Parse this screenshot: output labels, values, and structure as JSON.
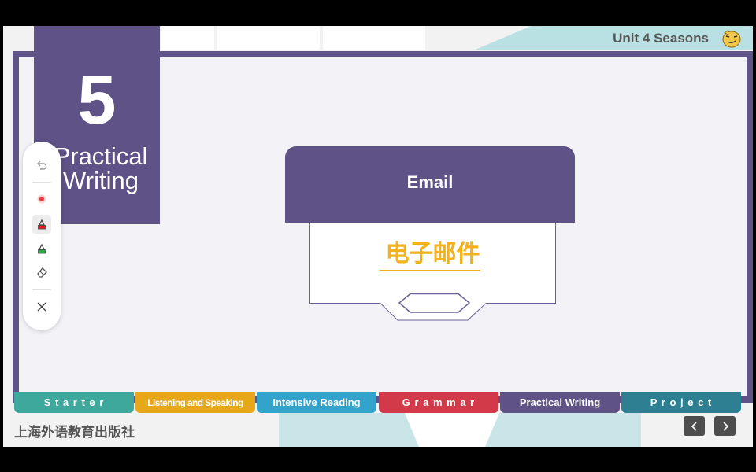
{
  "header": {
    "unit_title": "Unit 4 Seasons",
    "mascot_icon": "mascot-face-icon"
  },
  "section": {
    "number": "5",
    "title_line1": "Practical",
    "title_line2": "Writing"
  },
  "card": {
    "title": "Email",
    "subtitle": "电子邮件"
  },
  "tools": [
    {
      "name": "undo-icon"
    },
    {
      "name": "laser-pointer-icon"
    },
    {
      "name": "red-pen-icon"
    },
    {
      "name": "green-highlighter-icon"
    },
    {
      "name": "eraser-icon"
    },
    {
      "name": "close-icon"
    }
  ],
  "nav_tabs": [
    {
      "label": "S t a r t e r",
      "color": "#3fa89c"
    },
    {
      "label": "Listening and Speaking",
      "color": "#e6a818"
    },
    {
      "label": "Intensive Reading",
      "color": "#33a3cc"
    },
    {
      "label": "G r a m m a r",
      "color": "#d23a4a"
    },
    {
      "label": "Practical Writing",
      "color": "#5e5286"
    },
    {
      "label": "P r o j e c t",
      "color": "#2f7f92"
    }
  ],
  "footer": {
    "publisher": "上海外语教育出版社"
  },
  "colors": {
    "primary": "#5e5286",
    "accent": "#f2b21c",
    "frame_bg": "#f3f2f6"
  }
}
